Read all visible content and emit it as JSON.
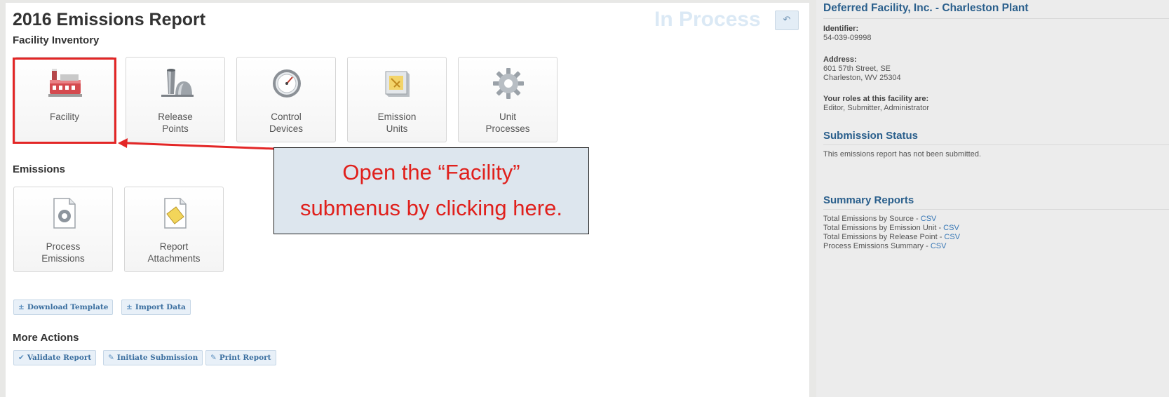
{
  "header": {
    "title": "2016 Emissions Report",
    "status": "In Process",
    "back_icon": "undo-arrow-icon"
  },
  "facility_inventory": {
    "heading": "Facility Inventory",
    "tiles": [
      {
        "line1": "Facility",
        "line2": "",
        "icon": "factory-icon"
      },
      {
        "line1": "Release",
        "line2": "Points",
        "icon": "stack-icon"
      },
      {
        "line1": "Control",
        "line2": "Devices",
        "icon": "gauge-icon"
      },
      {
        "line1": "Emission",
        "line2": "Units",
        "icon": "unit-box-icon"
      },
      {
        "line1": "Unit",
        "line2": "Processes",
        "icon": "gear-icon"
      }
    ]
  },
  "emissions": {
    "heading": "Emissions",
    "tiles": [
      {
        "line1": "Process",
        "line2": "Emissions",
        "icon": "gear-document-icon"
      },
      {
        "line1": "Report",
        "line2": "Attachments",
        "icon": "attachment-document-icon"
      }
    ],
    "buttons": [
      {
        "label": "Download Template",
        "icon": "download-icon"
      },
      {
        "label": "Import Data",
        "icon": "import-icon"
      }
    ]
  },
  "more_actions": {
    "heading": "More Actions",
    "buttons": [
      {
        "label": "Validate Report",
        "icon": "check-icon"
      },
      {
        "label": "Initiate Submission",
        "icon": "wrench-icon"
      },
      {
        "label": "Print Report",
        "icon": "wrench-icon"
      }
    ]
  },
  "callout": {
    "line1": "Open the “Facility”",
    "line2": "submenus by clicking here."
  },
  "sidebar": {
    "facility_name": "Deferred Facility, Inc. - Charleston Plant",
    "identifier_label": "Identifier:",
    "identifier_value": "54-039-09998",
    "address_label": "Address:",
    "address_line1": "601 57th Street, SE",
    "address_line2": "Charleston, WV 25304",
    "roles_label": "Your roles at this facility are:",
    "roles_value": "Editor, Submitter, Administrator",
    "submission_heading": "Submission Status",
    "submission_text": "This emissions report has not been submitted.",
    "summary_heading": "Summary Reports",
    "summary_reports": [
      {
        "label": "Total Emissions by Source  -  ",
        "link": "CSV"
      },
      {
        "label": "Total Emissions by Emission Unit  -  ",
        "link": "CSV"
      },
      {
        "label": "Total Emissions by Release Point  -  ",
        "link": "CSV"
      },
      {
        "label": "Process Emissions Summary  -  ",
        "link": "CSV"
      }
    ]
  },
  "colors": {
    "accent": "#2a5f8c",
    "highlight": "#e32626",
    "callout_bg": "#dde6ee"
  }
}
